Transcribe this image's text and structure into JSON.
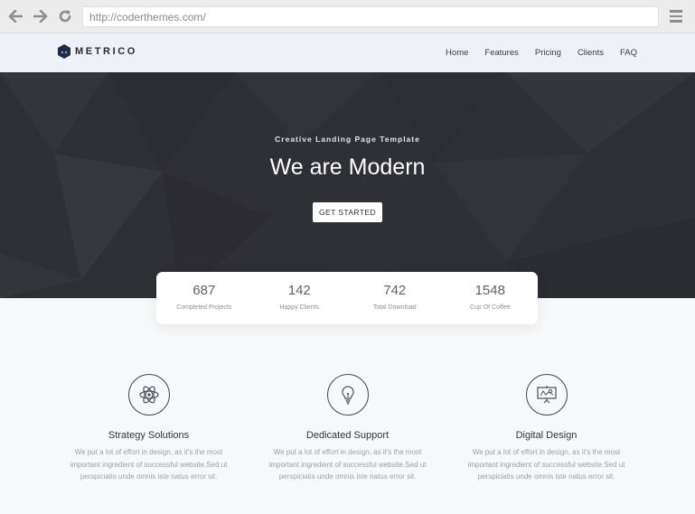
{
  "browser": {
    "url": "http://coderthemes.com/",
    "icons": [
      "back-arrow-icon",
      "forward-arrow-icon",
      "reload-icon",
      "hamburger-menu-icon"
    ]
  },
  "header": {
    "brand": "METRICO",
    "nav": [
      "Home",
      "Features",
      "Pricing",
      "Clients",
      "FAQ"
    ]
  },
  "hero": {
    "subtitle": "Creative Landing Page Template",
    "title": "We are Modern",
    "cta": "GET STARTED"
  },
  "stats": [
    {
      "value": "687",
      "label": "Completed Projects"
    },
    {
      "value": "142",
      "label": "Happy Clients"
    },
    {
      "value": "742",
      "label": "Total Download"
    },
    {
      "value": "1548",
      "label": "Cup Of Coffee"
    }
  ],
  "features": [
    {
      "icon": "atom-icon",
      "title": "Strategy Solutions",
      "desc": "We put a lot of effort in design, as it's the most important ingredient of successful website.Sed ut perspiciatis unde omnis iste natus error sit."
    },
    {
      "icon": "lightbulb-icon",
      "title": "Dedicated Support",
      "desc": "We put a lot of effort in design, as it's the most important ingredient of successful website.Sed ut perspiciatis unde omnis iste natus error sit."
    },
    {
      "icon": "presentation-board-icon",
      "title": "Digital Design",
      "desc": "We put a lot of effort in design, as it's the most important ingredient of successful website.Sed ut perspiciatis unde omnis iste natus error sit."
    }
  ],
  "colors": {
    "hero_bg": "#2f2f36",
    "header_bg": "#eef1f6",
    "page_bg": "#f7f8fa",
    "logo_mark": "#1f2a44"
  }
}
